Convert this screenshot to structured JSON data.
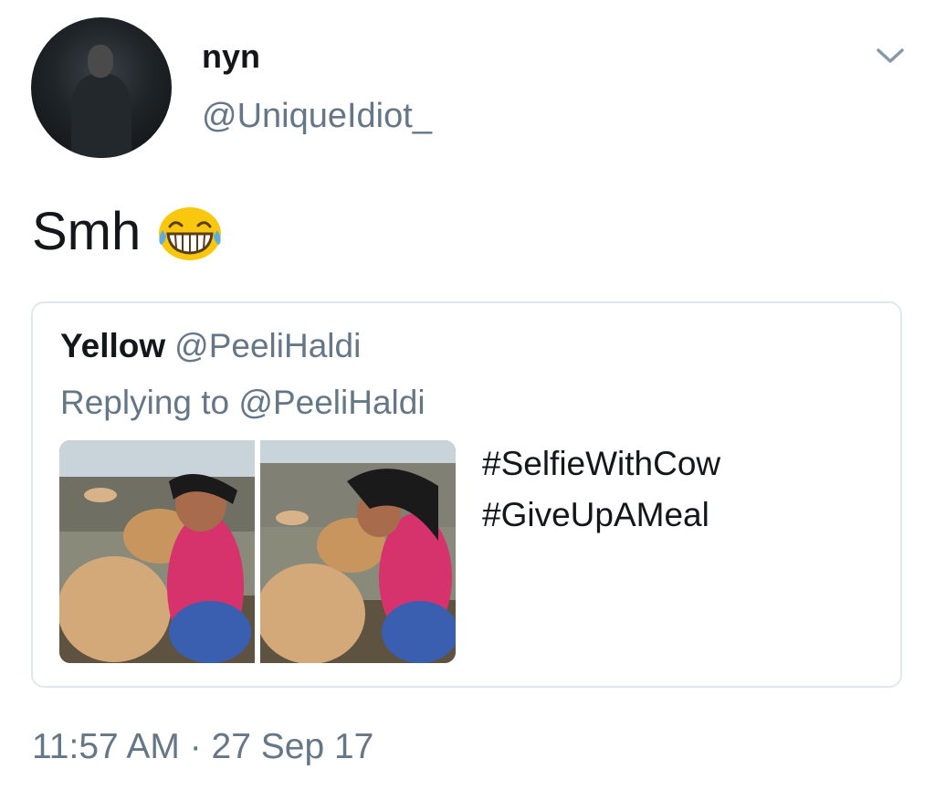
{
  "author": {
    "display_name": "nyn",
    "handle": "@UniqueIdiot_"
  },
  "tweet": {
    "text": "Smh",
    "emoji": "face-with-tears-of-joy",
    "timestamp": "11:57 AM · 27 Sep 17"
  },
  "quoted_tweet": {
    "display_name": "Yellow",
    "handle": "@PeeliHaldi",
    "replying_to": "Replying to @PeeliHaldi",
    "hashtags": [
      "#SelfieWithCow",
      "#GiveUpAMeal"
    ],
    "media_count": 2
  },
  "colors": {
    "primary_text": "#14171a",
    "secondary_text": "#657786",
    "card_border": "#e1e8ed"
  }
}
